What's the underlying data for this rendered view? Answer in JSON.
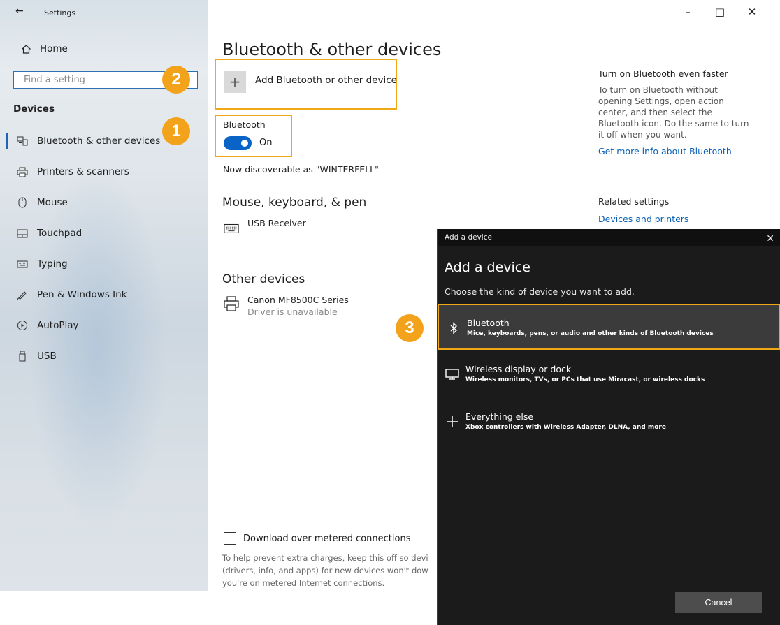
{
  "window": {
    "title": "Settings",
    "controls": {
      "minimize": "–",
      "maximize": "□",
      "close": "✕"
    }
  },
  "sidebar": {
    "home_label": "Home",
    "search_placeholder": "Find a setting",
    "section_label": "Devices",
    "items": [
      {
        "label": "Bluetooth & other devices",
        "icon": "bluetooth-devices-icon"
      },
      {
        "label": "Printers & scanners",
        "icon": "printer-icon"
      },
      {
        "label": "Mouse",
        "icon": "mouse-icon"
      },
      {
        "label": "Touchpad",
        "icon": "touchpad-icon"
      },
      {
        "label": "Typing",
        "icon": "keyboard-icon"
      },
      {
        "label": "Pen & Windows Ink",
        "icon": "pen-icon"
      },
      {
        "label": "AutoPlay",
        "icon": "autoplay-icon"
      },
      {
        "label": "USB",
        "icon": "usb-icon"
      }
    ],
    "active_index": 0
  },
  "main": {
    "title": "Bluetooth & other devices",
    "add_device_label": "Add Bluetooth or other device",
    "bluetooth_label": "Bluetooth",
    "bluetooth_state": "On",
    "discoverable_text": "Now discoverable as \"WINTERFELL\"",
    "mouse_section_title": "Mouse, keyboard, & pen",
    "mouse_devices": [
      {
        "name": "USB Receiver"
      }
    ],
    "other_section_title": "Other devices",
    "other_devices": [
      {
        "name": "Canon MF8500C Series",
        "status": "Driver is unavailable"
      }
    ],
    "metered_checkbox_label": "Download over metered connections",
    "metered_help_text": "To help prevent extra charges, keep this off so devi (drivers, info, and apps) for new devices won't dow you're on metered Internet connections."
  },
  "side_panel": {
    "title": "Turn on Bluetooth even faster",
    "text": "To turn on Bluetooth without opening Settings, open action center, and then select the Bluetooth icon. Do the same to turn it off when you want.",
    "link": "Get more info about Bluetooth",
    "related_title": "Related settings",
    "related_link": "Devices and printers"
  },
  "callouts": [
    "1",
    "2",
    "3"
  ],
  "dialog": {
    "title": "Add a device",
    "heading": "Add a device",
    "subtitle": "Choose the kind of device you want to add.",
    "options": [
      {
        "title": "Bluetooth",
        "desc": "Mice, keyboards, pens, or audio and other kinds of Bluetooth devices",
        "icon": "bluetooth-icon"
      },
      {
        "title": "Wireless display or dock",
        "desc": "Wireless monitors, TVs, or PCs that use Miracast, or wireless docks",
        "icon": "monitor-icon"
      },
      {
        "title": "Everything else",
        "desc": "Xbox controllers with Wireless Adapter, DLNA, and more",
        "icon": "plus-icon"
      }
    ],
    "cancel_label": "Cancel"
  },
  "colors": {
    "accent": "#0a64c8",
    "highlight": "#f0a817",
    "callout": "#f3a21b",
    "dialog_bg": "#1b1b1b",
    "link": "#0a5fb4"
  }
}
